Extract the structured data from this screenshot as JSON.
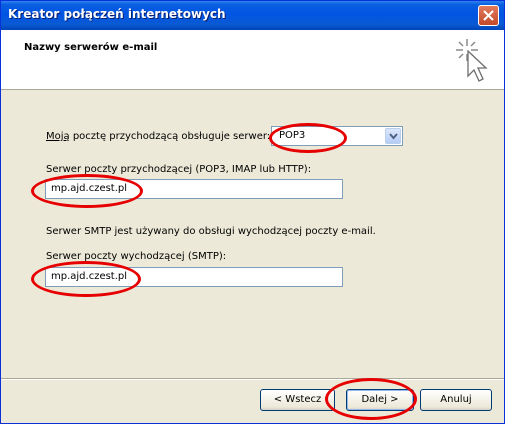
{
  "window": {
    "title": "Kreator połączeń internetowych"
  },
  "header": {
    "title": "Nazwy serwerów e-mail"
  },
  "form": {
    "incoming_type_label_prefix": "Moją",
    "incoming_type_label_rest": " pocztę przychodzącą obsługuje serwer:",
    "incoming_type_value": "POP3",
    "incoming_server_label_prefix": "Serwer poczty przychodzącej (POP3, IMAP lub HTTP):",
    "incoming_server_value": "mp.ajd.czest.pl",
    "smtp_info": "Serwer SMTP jest używany do obsługi wychodzącej poczty e-mail.",
    "outgoing_server_label": "Serwer poczty wychodzącej (SMTP):",
    "outgoing_server_value": "mp.ajd.czest.pl"
  },
  "buttons": {
    "back": "< Wstecz",
    "next": "Dalej >",
    "cancel": "Anuluj"
  },
  "annotation_color": "#e60000"
}
